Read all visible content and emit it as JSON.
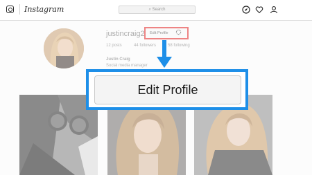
{
  "topbar": {
    "wordmark": "Instagram",
    "search_placeholder": "Search",
    "icons": [
      "instagram-logo-icon",
      "compass-icon",
      "heart-icon",
      "person-icon"
    ]
  },
  "profile": {
    "username": "justincraig2",
    "edit_button_label": "Edit Profile",
    "posts": "12 posts",
    "followers": "44 followers",
    "following": "58 following",
    "full_name": "Justin Craig",
    "bio": "Social media manager"
  },
  "callout": {
    "label": "Edit Profile",
    "frame_color": "#1e8fe8",
    "highlight_color": "#e02020"
  }
}
